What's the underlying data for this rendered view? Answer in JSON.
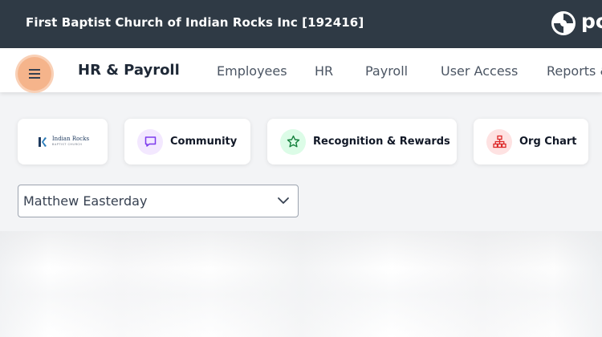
{
  "header": {
    "org_name": "First Baptist Church of Indian Rocks Inc [192416]",
    "brand_text": "pc"
  },
  "nav": {
    "title": "HR & Payroll",
    "links": [
      "Employees",
      "HR",
      "Payroll",
      "User Access",
      "Reports &"
    ]
  },
  "quick_links": {
    "logo_text": "Indian Rocks",
    "logo_subtext": "BAPTIST CHURCH",
    "cards": [
      {
        "label": "Community",
        "icon": "chat-bubble-icon"
      },
      {
        "label": "Recognition & Rewards",
        "icon": "star-icon"
      },
      {
        "label": "Org Chart",
        "icon": "org-chart-icon"
      }
    ]
  },
  "employee_select": {
    "value": "Matthew Easterday"
  },
  "colors": {
    "topbar": "#2f3a45",
    "menu_button": "#f5b48b",
    "community_icon_bg": "#f3e8ff",
    "recognition_icon_bg": "#dcfce7",
    "orgchart_icon_bg": "#fee2e2"
  }
}
